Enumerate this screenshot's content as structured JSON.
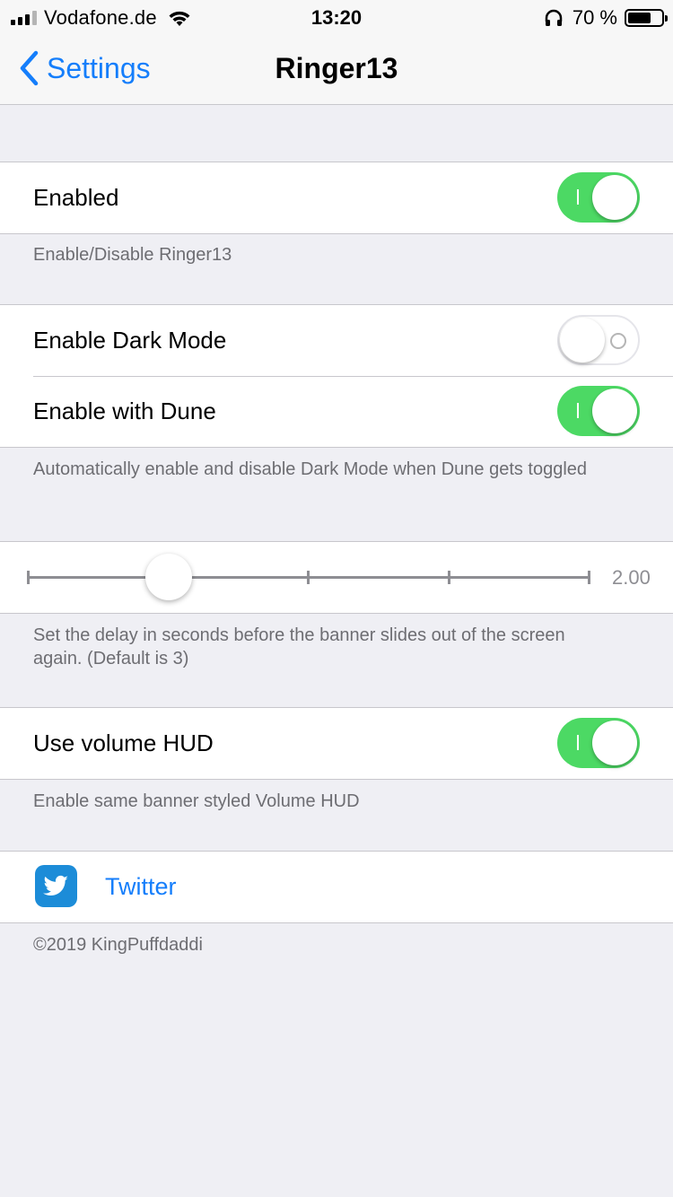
{
  "status_bar": {
    "carrier": "Vodafone.de",
    "time": "13:20",
    "battery_percent": "70 %",
    "battery_level": 0.7,
    "icons": [
      "signal-icon",
      "wifi-icon",
      "headphones-icon",
      "battery-icon"
    ]
  },
  "nav": {
    "back_label": "Settings",
    "title": "Ringer13"
  },
  "sections": {
    "enabled": {
      "label": "Enabled",
      "on": true,
      "footer": "Enable/Disable Ringer13"
    },
    "dark_mode": {
      "label": "Enable Dark Mode",
      "on": false
    },
    "dune": {
      "label": "Enable with Dune",
      "on": true,
      "footer": "Automatically enable and disable Dark Mode when Dune gets toggled"
    },
    "delay": {
      "value_text": "2.00",
      "value": 2.0,
      "footer": "Set the delay in seconds before the banner slides out of the screen again. (Default is 3)"
    },
    "volume_hud": {
      "label": "Use volume HUD",
      "on": true,
      "footer": "Enable same banner styled Volume HUD"
    },
    "twitter": {
      "label": "Twitter",
      "icon": "twitter-icon"
    }
  },
  "copyright": "©2019 KingPuffdaddi",
  "colors": {
    "accent": "#157efb",
    "switch_on": "#4cd964",
    "background": "#efeff4",
    "twitter_blue": "#1c8cd8"
  }
}
